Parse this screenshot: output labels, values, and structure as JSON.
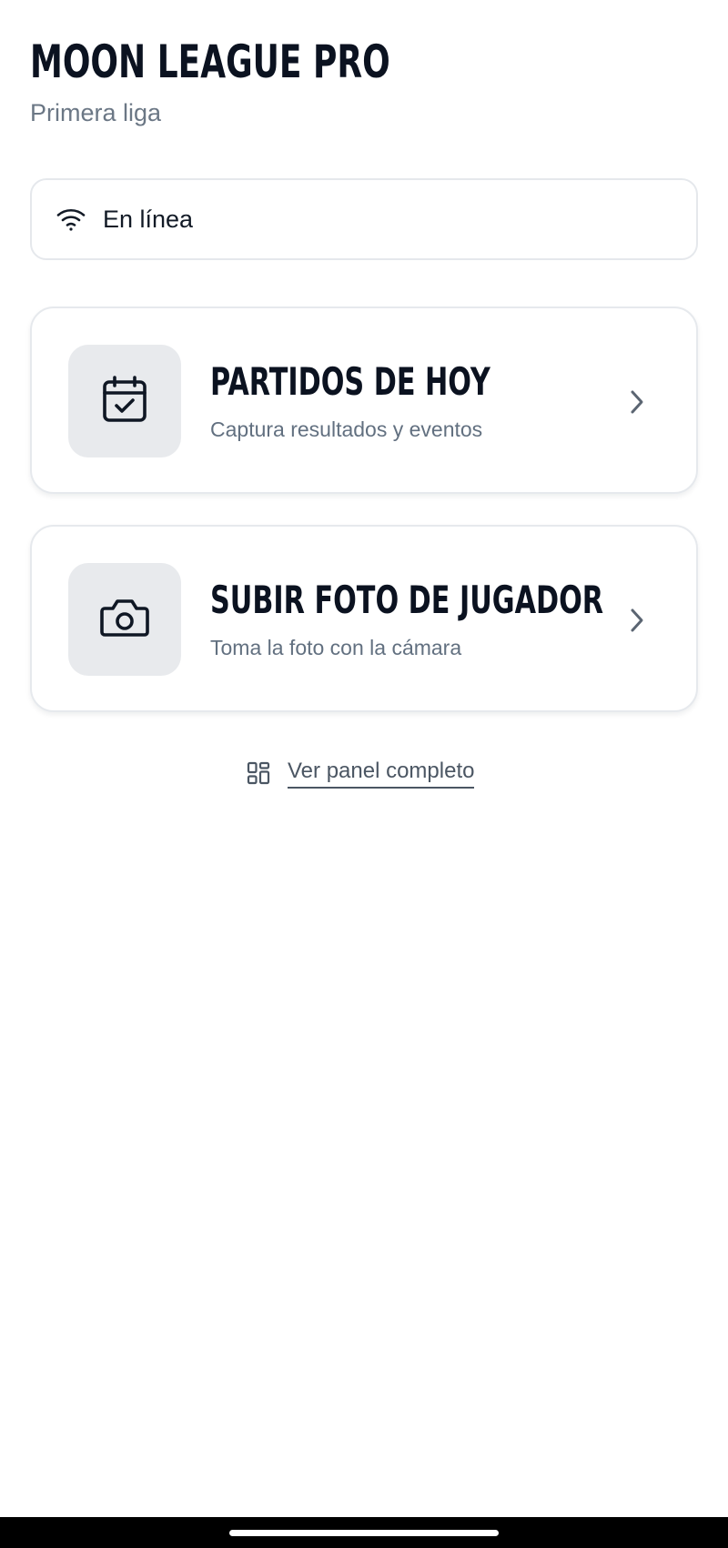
{
  "header": {
    "title": "MOON LEAGUE PRO",
    "subtitle": "Primera liga"
  },
  "connection": {
    "icon": "wifi-icon",
    "status_text": "En línea"
  },
  "cards": [
    {
      "icon": "calendar-check-icon",
      "title": "PARTIDOS DE HOY",
      "description": "Captura resultados y eventos",
      "chevron_icon": "chevron-right-icon"
    },
    {
      "icon": "camera-icon",
      "title": "SUBIR FOTO DE JUGADOR",
      "description": "Toma la foto con la cámara",
      "chevron_icon": "chevron-right-icon"
    }
  ],
  "panel_link": {
    "icon": "grid-icon",
    "label": "Ver panel completo"
  },
  "colors": {
    "title": "#0b1220",
    "muted": "#6b7785",
    "card_border": "#e6e9ed",
    "icon_tile": "#e8eaed",
    "link": "#4b5663"
  }
}
